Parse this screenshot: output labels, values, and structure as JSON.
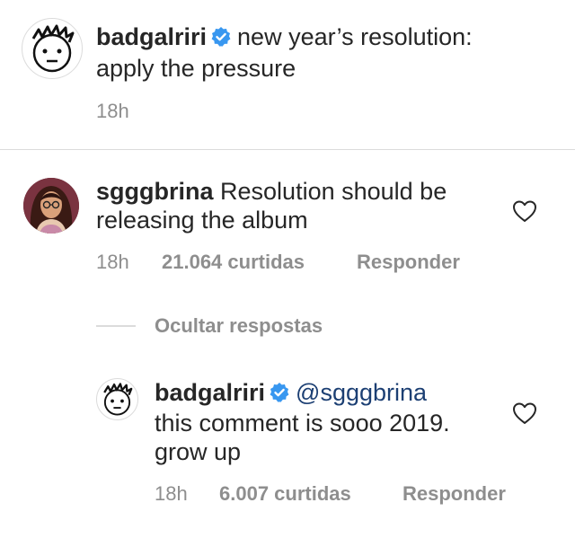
{
  "caption": {
    "username": "badgalriri",
    "text_line1": "new year’s resolution:",
    "text_line2": "apply the pressure",
    "time": "18h"
  },
  "comment": {
    "username": "sgggbrina",
    "text_line1": "Resolution should be",
    "text_line2": "releasing the album",
    "time": "18h",
    "likes": "21.064 curtidas",
    "reply_label": "Responder"
  },
  "hide_replies_label": "Ocultar respostas",
  "reply": {
    "username": "badgalriri",
    "mention": "@sgggbrina",
    "text_line1": "this comment is sooo 2019.",
    "text_line2": "grow up",
    "time": "18h",
    "likes": "6.007 curtidas",
    "reply_label": "Responder"
  },
  "icons": {
    "verified": "verified-badge-icon",
    "like": "heart-outline-icon"
  },
  "colors": {
    "verified_blue": "#3897f0",
    "muted_text": "#8e8e8e",
    "mention": "#1c3f73"
  }
}
